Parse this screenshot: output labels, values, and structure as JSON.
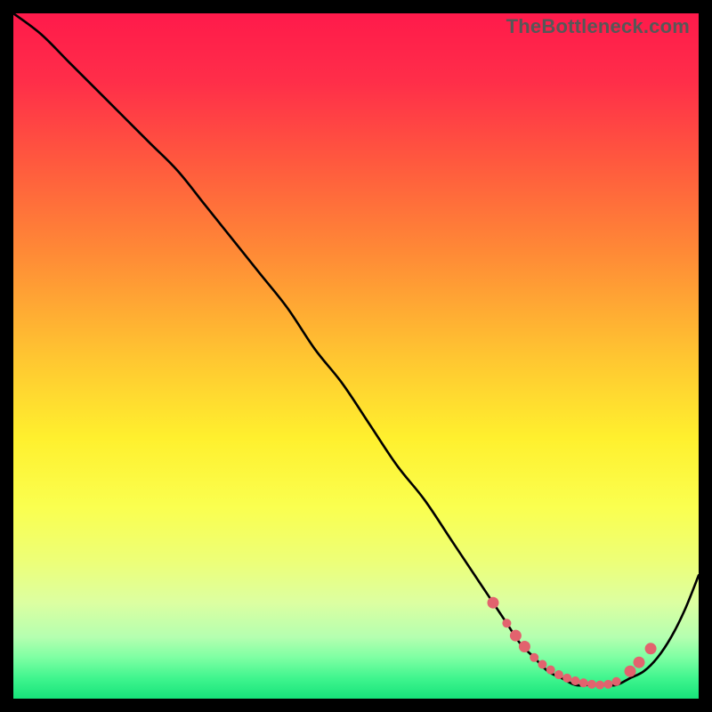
{
  "watermark": "TheBottleneck.com",
  "chart_data": {
    "type": "line",
    "title": "",
    "xlabel": "",
    "ylabel": "",
    "xlim": [
      0,
      100
    ],
    "ylim": [
      0,
      100
    ],
    "gradient_stops": [
      {
        "offset": 0,
        "color": "#ff1a4b"
      },
      {
        "offset": 10,
        "color": "#ff2e49"
      },
      {
        "offset": 22,
        "color": "#ff5a3e"
      },
      {
        "offset": 35,
        "color": "#ff8a36"
      },
      {
        "offset": 50,
        "color": "#ffc531"
      },
      {
        "offset": 62,
        "color": "#fff02e"
      },
      {
        "offset": 72,
        "color": "#faff4f"
      },
      {
        "offset": 80,
        "color": "#edff78"
      },
      {
        "offset": 86,
        "color": "#dcffa1"
      },
      {
        "offset": 91,
        "color": "#b5ffb0"
      },
      {
        "offset": 94,
        "color": "#7effa3"
      },
      {
        "offset": 97,
        "color": "#40f58e"
      },
      {
        "offset": 100,
        "color": "#17e37a"
      }
    ],
    "series": [
      {
        "name": "bottleneck-curve",
        "x": [
          0,
          4,
          8,
          12,
          16,
          20,
          24,
          28,
          32,
          36,
          40,
          44,
          48,
          52,
          56,
          60,
          64,
          68,
          70,
          72,
          74,
          76,
          78,
          80,
          82,
          84,
          86,
          88,
          90,
          92,
          94,
          96,
          98,
          100
        ],
        "y": [
          100,
          97,
          93,
          89,
          85,
          81,
          77,
          72,
          67,
          62,
          57,
          51,
          46,
          40,
          34,
          29,
          23,
          17,
          14,
          11,
          8,
          6,
          4,
          3,
          2,
          2,
          2,
          2,
          3,
          4,
          6,
          9,
          13,
          18
        ]
      }
    ],
    "markers": {
      "name": "highlighted-range",
      "color": "#e2636e",
      "radius_small": 5,
      "radius_large": 6.5,
      "points": [
        {
          "x": 70,
          "y": 14,
          "r": "l"
        },
        {
          "x": 72,
          "y": 11,
          "r": "s"
        },
        {
          "x": 73.3,
          "y": 9.2,
          "r": "l"
        },
        {
          "x": 74.6,
          "y": 7.6,
          "r": "l"
        },
        {
          "x": 76,
          "y": 6,
          "r": "s"
        },
        {
          "x": 77.2,
          "y": 5,
          "r": "s"
        },
        {
          "x": 78.4,
          "y": 4.2,
          "r": "s"
        },
        {
          "x": 79.6,
          "y": 3.5,
          "r": "s"
        },
        {
          "x": 80.8,
          "y": 3,
          "r": "s"
        },
        {
          "x": 82,
          "y": 2.6,
          "r": "s"
        },
        {
          "x": 83.2,
          "y": 2.3,
          "r": "s"
        },
        {
          "x": 84.4,
          "y": 2.1,
          "r": "s"
        },
        {
          "x": 85.6,
          "y": 2,
          "r": "s"
        },
        {
          "x": 86.8,
          "y": 2.1,
          "r": "s"
        },
        {
          "x": 88,
          "y": 2.5,
          "r": "s"
        },
        {
          "x": 90,
          "y": 4,
          "r": "l"
        },
        {
          "x": 91.3,
          "y": 5.3,
          "r": "l"
        },
        {
          "x": 93,
          "y": 7.3,
          "r": "l"
        }
      ]
    }
  }
}
